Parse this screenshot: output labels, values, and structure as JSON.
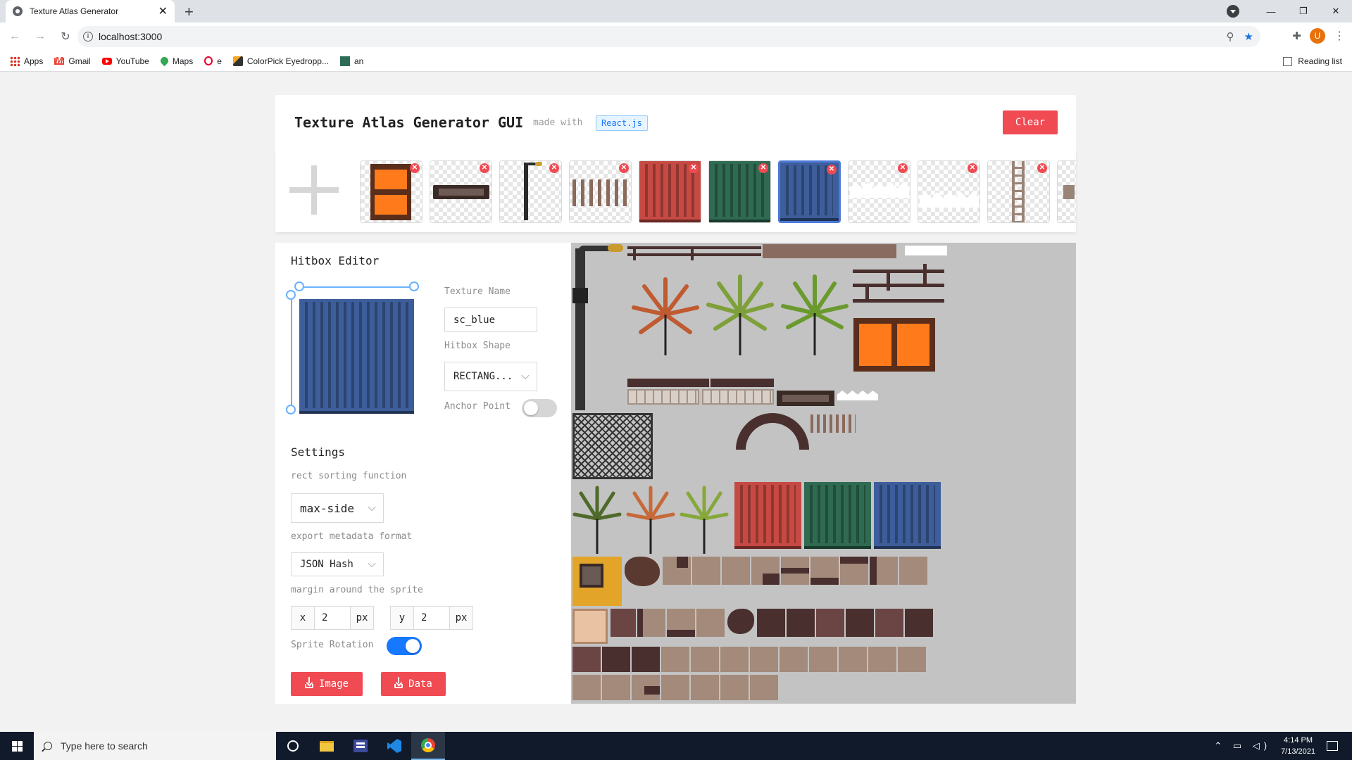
{
  "browser": {
    "tab_title": "Texture Atlas Generator",
    "url": "localhost:3000",
    "profile_initial": "U",
    "bookmarks": [
      "Apps",
      "Gmail",
      "YouTube",
      "Maps",
      "e",
      "ColorPick Eyedropp...",
      "an"
    ],
    "reading_list": "Reading list"
  },
  "app": {
    "title": "Texture Atlas Generator GUI",
    "made_with": "made with",
    "framework": "React.js",
    "clear_label": "Clear",
    "selected_thumbnail_index": 6
  },
  "hitbox_editor": {
    "heading": "Hitbox Editor",
    "texture_name_label": "Texture Name",
    "texture_name_value": "sc_blue",
    "hitbox_shape_label": "Hitbox Shape",
    "hitbox_shape_value": "RECTANG...",
    "anchor_point_label": "Anchor Point",
    "anchor_point_on": false
  },
  "settings": {
    "heading": "Settings",
    "sorting_label": "rect sorting function",
    "sorting_value": "max-side",
    "export_label": "export metadata format",
    "export_value": "JSON Hash",
    "margin_label": "margin around the sprite",
    "margin_x_prefix": "x",
    "margin_x": "2",
    "margin_y_prefix": "y",
    "margin_y": "2",
    "unit": "px",
    "rotation_label": "Sprite Rotation",
    "rotation_on": true,
    "image_button": "Image",
    "data_button": "Data"
  },
  "taskbar": {
    "search_placeholder": "Type here to search",
    "time": "4:14 PM",
    "date": "7/13/2021"
  },
  "colors": {
    "accent_red": "#f04a52",
    "toggle_blue": "#1677ff",
    "container_red": "#c64a43",
    "container_green": "#2f6b52",
    "container_blue": "#3d5e9b"
  }
}
